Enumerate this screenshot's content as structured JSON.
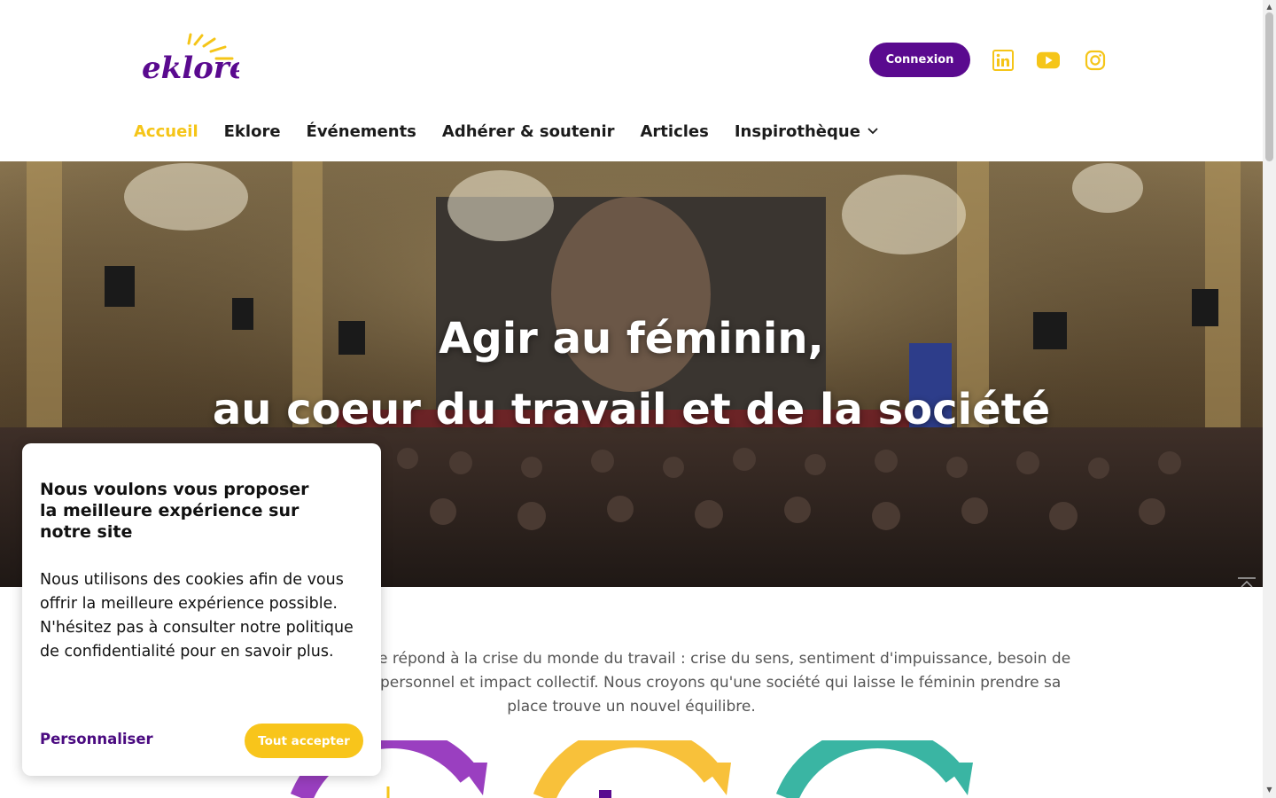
{
  "brand": {
    "logo_text": "eklore"
  },
  "header": {
    "connexion_label": "Connexion",
    "social": [
      {
        "name": "linkedin-icon"
      },
      {
        "name": "youtube-icon"
      },
      {
        "name": "instagram-icon"
      }
    ]
  },
  "nav": {
    "items": [
      {
        "label": "Accueil",
        "active": true
      },
      {
        "label": "Eklore"
      },
      {
        "label": "Événements"
      },
      {
        "label": "Adhérer & soutenir"
      },
      {
        "label": "Articles"
      },
      {
        "label": "Inspirothèque",
        "has_dropdown": true
      }
    ]
  },
  "hero": {
    "line1": "Agir au féminin,",
    "line2": "au coeur du travail et de la société"
  },
  "intro": {
    "text_line1": "ore répond à la crise du monde du travail : crise du sens, sentiment d'impuissance, besoin de",
    "text_line2": "personnel et impact collectif. Nous croyons qu'une société qui laisse le féminin prendre sa",
    "text_line3": "place trouve un nouvel équilibre."
  },
  "cookie": {
    "title": "Nous voulons vous proposer la meilleure expérience sur notre site",
    "body": "Nous utilisons des cookies afin de vous offrir la meilleure expérience possible. N'hésitez pas à consulter notre politique de confidentialité pour en savoir plus.",
    "customize_label": "Personnaliser",
    "accept_label": "Tout accepter"
  },
  "colors": {
    "brand_purple": "#5a0a8f",
    "brand_yellow": "#f5c518",
    "circle_purple": "#9a3fc0",
    "circle_yellow": "#f8c13a",
    "circle_teal": "#3ab5a3"
  }
}
